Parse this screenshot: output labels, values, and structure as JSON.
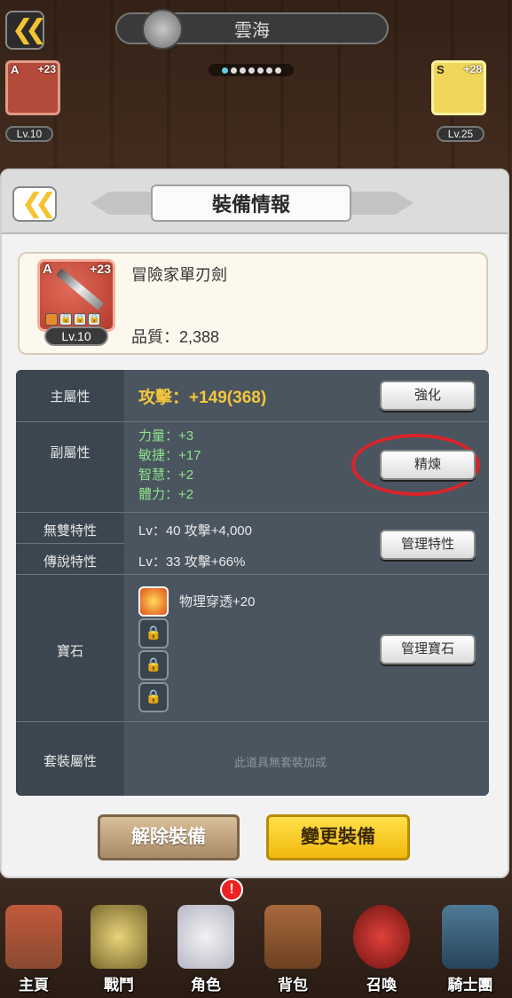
{
  "top_bar": {
    "title": "雲海",
    "back_icon": "double-chevron-left-icon"
  },
  "page_dots": {
    "count": 7,
    "active_index": 0
  },
  "side_cards": {
    "left": {
      "grade": "A",
      "plus": "+23",
      "level": "Lv.10"
    },
    "right": {
      "grade": "S",
      "plus": "+28",
      "level": "Lv.25"
    }
  },
  "panel": {
    "title": "裝備情報",
    "item": {
      "grade": "A",
      "plus": "+23",
      "level": "Lv.10",
      "name": "冒險家單刃劍",
      "quality": "品質：2,388"
    },
    "stats": {
      "main": {
        "label": "主屬性",
        "value": "攻擊：+149(368)",
        "button": "強化"
      },
      "sub": {
        "label": "副屬性",
        "values": [
          "力量：+3",
          "敏捷：+17",
          "智慧：+2",
          "體力：+2"
        ],
        "button": "精煉"
      },
      "unique": {
        "label": "無雙特性",
        "value": "Lv：40  攻擊+4,000"
      },
      "legend": {
        "label": "傳說特性",
        "value": "Lv：33  攻擊+66%"
      },
      "trait_button": "管理特性",
      "gems": {
        "label": "寶石",
        "slot1": "物理穿透+20",
        "button": "管理寶石"
      },
      "set": {
        "label": "套裝屬性",
        "note": "此道具無套裝加成"
      }
    },
    "actions": {
      "unequip": "解除裝備",
      "change": "變更裝備"
    }
  },
  "nav": {
    "items": [
      "主頁",
      "戰鬥",
      "角色",
      "背包",
      "召喚",
      "騎士團"
    ],
    "badge": "!"
  },
  "colors": {
    "highlight_circle": "#d8242a",
    "attack": "#f3c63b",
    "sub_stat": "#8fe38a"
  }
}
